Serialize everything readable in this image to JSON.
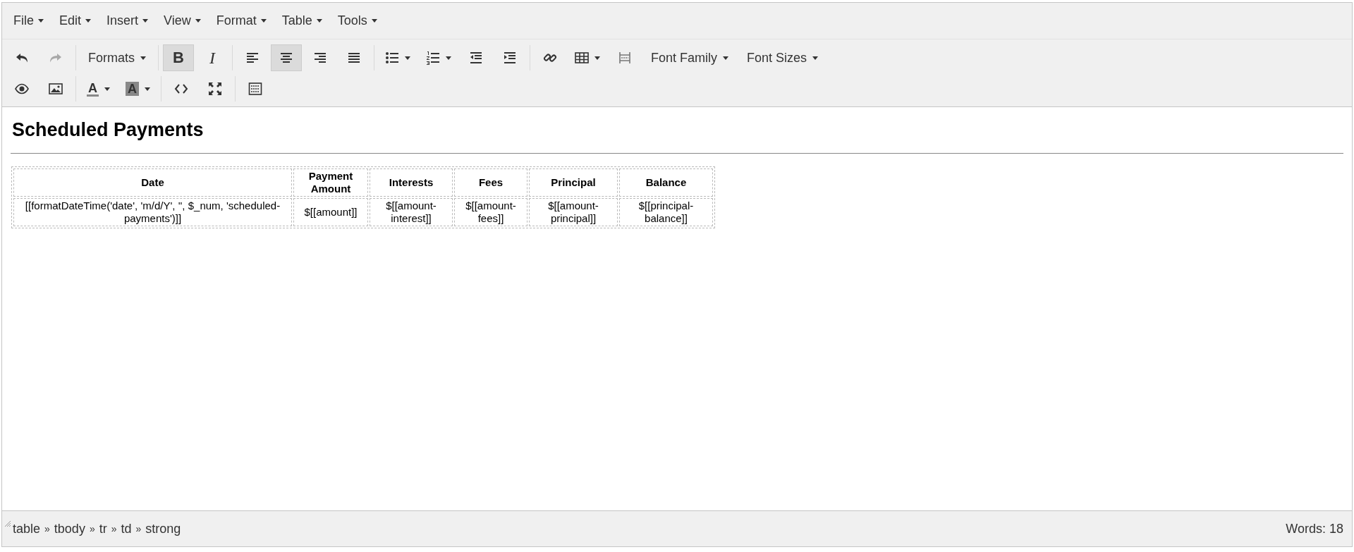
{
  "menubar": [
    {
      "label": "File"
    },
    {
      "label": "Edit"
    },
    {
      "label": "Insert"
    },
    {
      "label": "View"
    },
    {
      "label": "Format"
    },
    {
      "label": "Table"
    },
    {
      "label": "Tools"
    }
  ],
  "toolbar": {
    "rows": [
      [
        [
          {
            "kind": "undo",
            "disabled": false
          },
          {
            "kind": "redo",
            "disabled": true
          }
        ],
        [
          {
            "kind": "dropdown",
            "label": "Formats"
          }
        ],
        [
          {
            "kind": "bold",
            "label": "B",
            "pressed": true
          },
          {
            "kind": "italic",
            "label": "I",
            "pressed": false
          }
        ],
        [
          {
            "kind": "align-left",
            "pressed": false
          },
          {
            "kind": "align-center",
            "pressed": true
          },
          {
            "kind": "align-right",
            "pressed": false
          },
          {
            "kind": "align-justify",
            "pressed": false
          }
        ],
        [
          {
            "kind": "bullet-list"
          },
          {
            "kind": "numbered-list"
          },
          {
            "kind": "outdent"
          },
          {
            "kind": "indent"
          }
        ],
        [
          {
            "kind": "link"
          },
          {
            "kind": "table"
          },
          {
            "kind": "nonbreaking"
          },
          {
            "kind": "dropdown",
            "label": "Font Family"
          },
          {
            "kind": "dropdown",
            "label": "Font Sizes"
          }
        ]
      ],
      [
        [
          {
            "kind": "preview"
          },
          {
            "kind": "image"
          }
        ],
        [
          {
            "kind": "text-color",
            "label": "A"
          },
          {
            "kind": "background-color",
            "label": "A"
          }
        ],
        [
          {
            "kind": "code"
          },
          {
            "kind": "fullscreen"
          }
        ],
        [
          {
            "kind": "template"
          }
        ]
      ]
    ]
  },
  "document": {
    "heading": "Scheduled Payments",
    "table": {
      "columns": [
        "Date",
        "Payment Amount",
        "Interests",
        "Fees",
        "Principal",
        "Balance"
      ],
      "rows": [
        [
          "[[formatDateTime('date', 'm/d/Y', '', $_num, 'scheduled-payments')]]",
          "$[[amount]]",
          "$[[amount-interest]]",
          "$[[amount-fees]]",
          "$[[amount-principal]]",
          "$[[principal-balance]]"
        ]
      ]
    }
  },
  "status_bar": {
    "path": [
      "table",
      "tbody",
      "tr",
      "td",
      "strong"
    ],
    "separator": "»",
    "word_count": "Words: 18"
  }
}
